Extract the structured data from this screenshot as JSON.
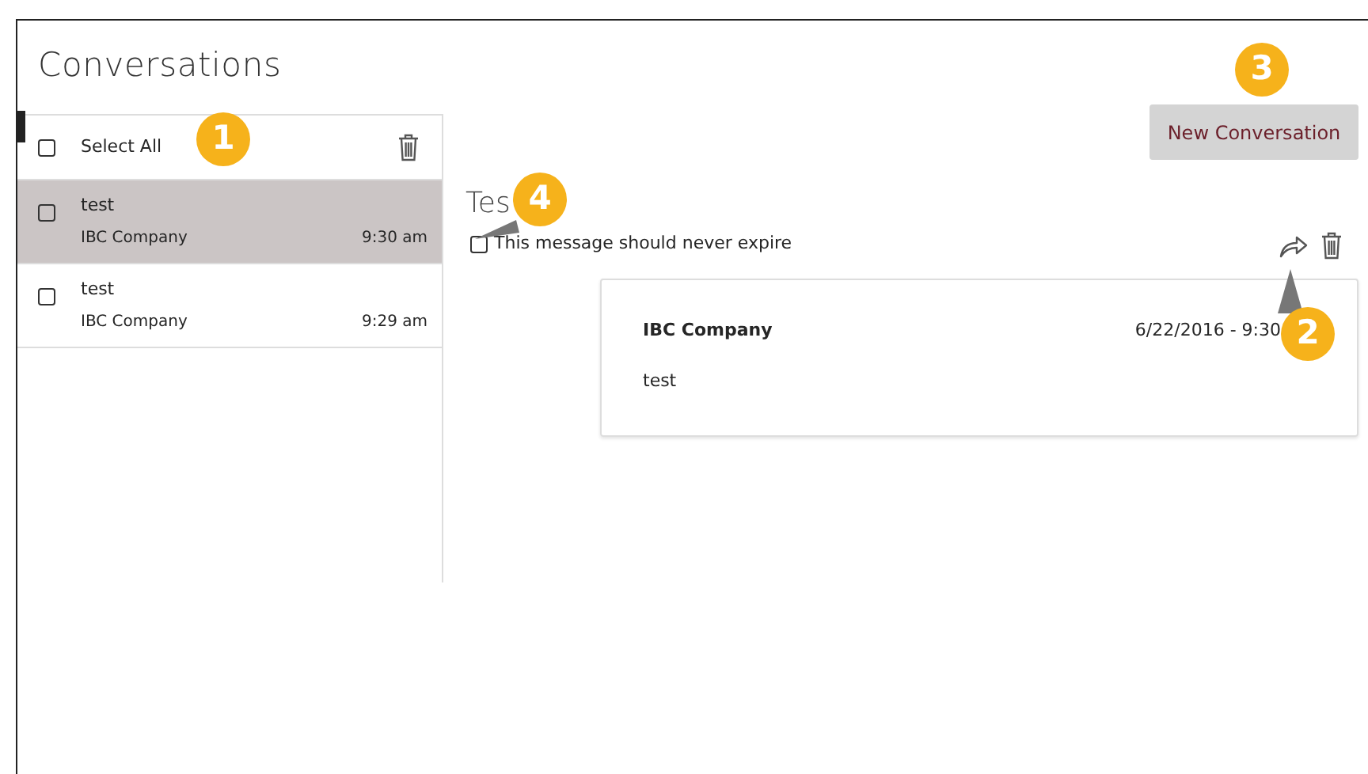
{
  "page_title": "Conversations",
  "list": {
    "select_all": {
      "label": "Select All",
      "checked": false
    },
    "items": [
      {
        "subject": "test",
        "sender": "IBC Company",
        "time": "9:30 am",
        "selected": true,
        "checked": false
      },
      {
        "subject": "test",
        "sender": "IBC Company",
        "time": "9:29 am",
        "selected": false,
        "checked": false
      }
    ]
  },
  "new_button": "New Conversation",
  "detail": {
    "title": "Tes",
    "never_expire": {
      "label": "This message should never expire",
      "checked": false
    },
    "messages": [
      {
        "sender": "IBC Company",
        "date": "6/22/2016 - 9:30",
        "body": "test"
      }
    ]
  },
  "callouts": [
    {
      "number": "1",
      "kind": "plain"
    },
    {
      "number": "2",
      "kind": "pointer_up"
    },
    {
      "number": "3",
      "kind": "plain"
    },
    {
      "number": "4",
      "kind": "pointer_down"
    }
  ]
}
